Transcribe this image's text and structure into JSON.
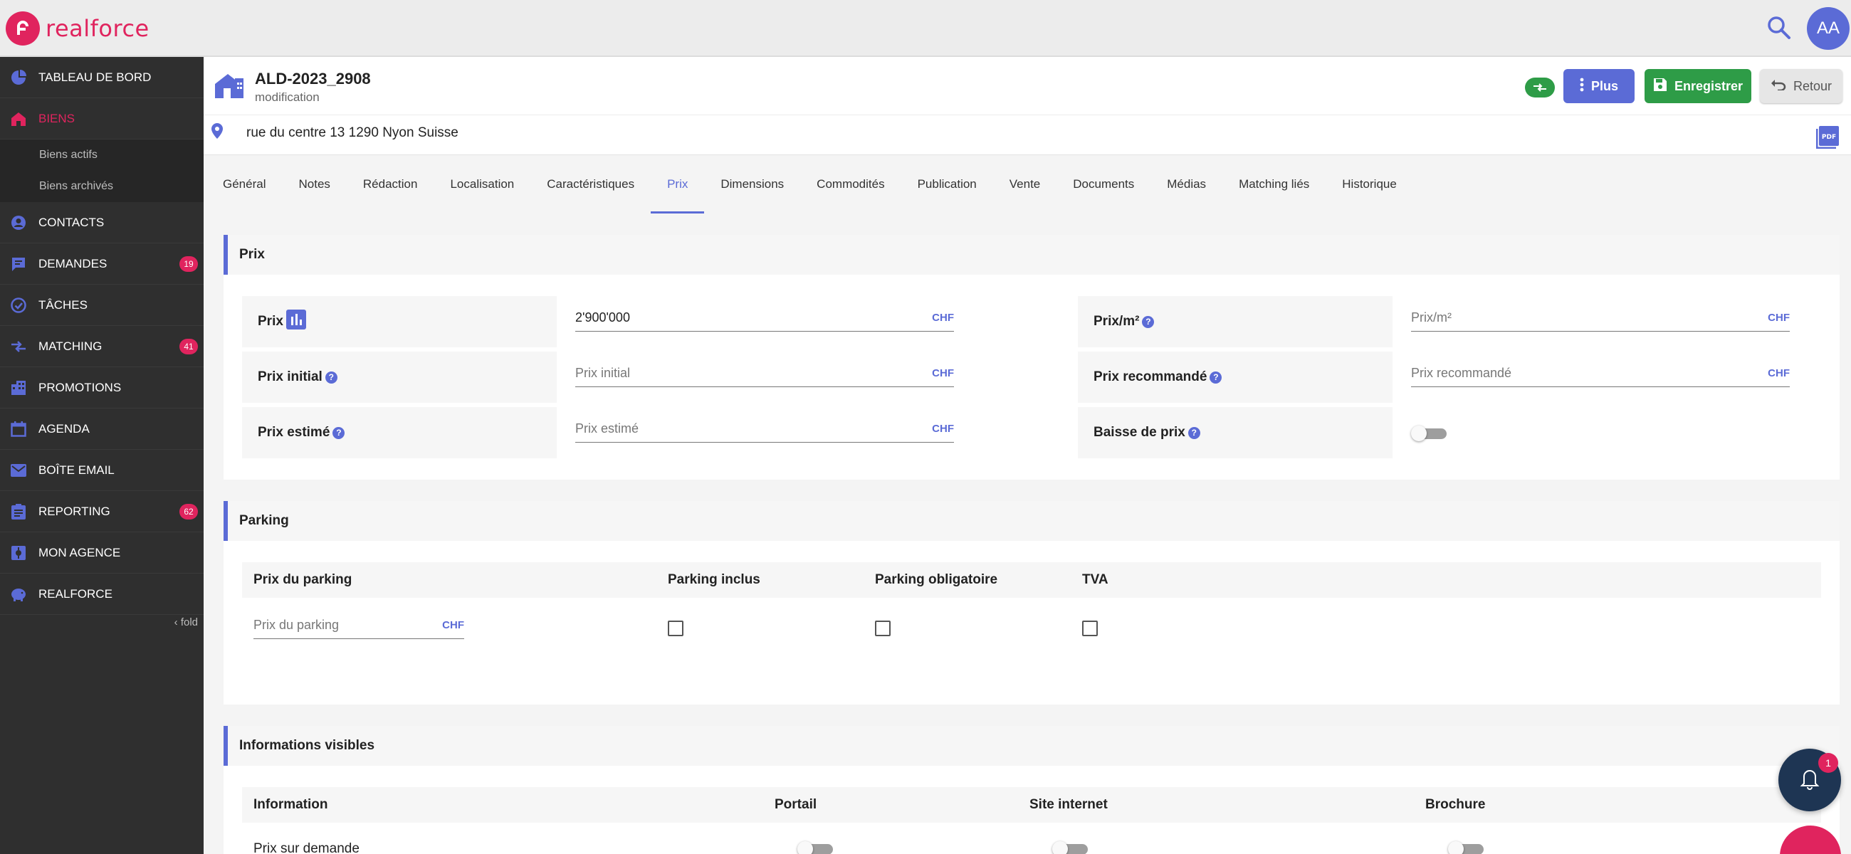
{
  "brand": {
    "name": "realforce",
    "color": "#e0245e"
  },
  "user": {
    "initials": "AA"
  },
  "sidebar": {
    "items": [
      {
        "label": "TABLEAU DE BORD",
        "icon": "dashboard-icon"
      },
      {
        "label": "BIENS",
        "icon": "home-icon",
        "active": true
      },
      {
        "label": "CONTACTS",
        "icon": "contact-icon"
      },
      {
        "label": "DEMANDES",
        "icon": "chat-icon",
        "badge": "19"
      },
      {
        "label": "TÂCHES",
        "icon": "check-circle-icon"
      },
      {
        "label": "MATCHING",
        "icon": "swap-icon",
        "badge": "41"
      },
      {
        "label": "PROMOTIONS",
        "icon": "building-icon"
      },
      {
        "label": "AGENDA",
        "icon": "calendar-icon"
      },
      {
        "label": "BOÎTE EMAIL",
        "icon": "mail-icon"
      },
      {
        "label": "REPORTING",
        "icon": "clipboard-icon",
        "badge": "62"
      },
      {
        "label": "MON AGENCE",
        "icon": "agency-icon"
      },
      {
        "label": "REALFORCE",
        "icon": "piggy-bank-icon"
      }
    ],
    "sub_items": [
      "Biens actifs",
      "Biens archivés"
    ],
    "fold_label": "fold"
  },
  "header": {
    "reference": "ALD-2023_2908",
    "subtitle": "modification",
    "plus_label": "Plus",
    "save_label": "Enregistrer",
    "back_label": "Retour",
    "address": "rue du centre 13 1290 Nyon Suisse"
  },
  "tabs": [
    "Général",
    "Notes",
    "Rédaction",
    "Localisation",
    "Caractéristiques",
    "Prix",
    "Dimensions",
    "Commodités",
    "Publication",
    "Vente",
    "Documents",
    "Médias",
    "Matching liés",
    "Historique"
  ],
  "active_tab": "Prix",
  "prix": {
    "title": "Prix",
    "prix_label": "Prix",
    "prix_value": "2'900'000",
    "currency": "CHF",
    "prix_m2_label": "Prix/m²",
    "prix_m2_placeholder": "Prix/m²",
    "initial_label": "Prix initial",
    "initial_placeholder": "Prix initial",
    "recommande_label": "Prix recommandé",
    "recommande_placeholder": "Prix recommandé",
    "estime_label": "Prix estimé",
    "estime_placeholder": "Prix estimé",
    "baisse_label": "Baisse de prix",
    "baisse_on": false
  },
  "parking": {
    "title": "Parking",
    "col_prix": "Prix du parking",
    "col_inclus": "Parking inclus",
    "col_obligatoire": "Parking obligatoire",
    "col_tva": "TVA",
    "prix_placeholder": "Prix du parking",
    "currency": "CHF",
    "inclus_checked": false,
    "obligatoire_checked": false,
    "tva_checked": false
  },
  "infos": {
    "title": "Informations visibles",
    "col_information": "Information",
    "col_portail": "Portail",
    "col_site": "Site internet",
    "col_brochure": "Brochure",
    "row_label": "Prix sur demande"
  },
  "notifications": {
    "count": "1"
  },
  "colors": {
    "accent": "#5b6bd6",
    "success": "#2e9c47",
    "sidebar": "#2f2f2f",
    "brand": "#e0245e"
  }
}
